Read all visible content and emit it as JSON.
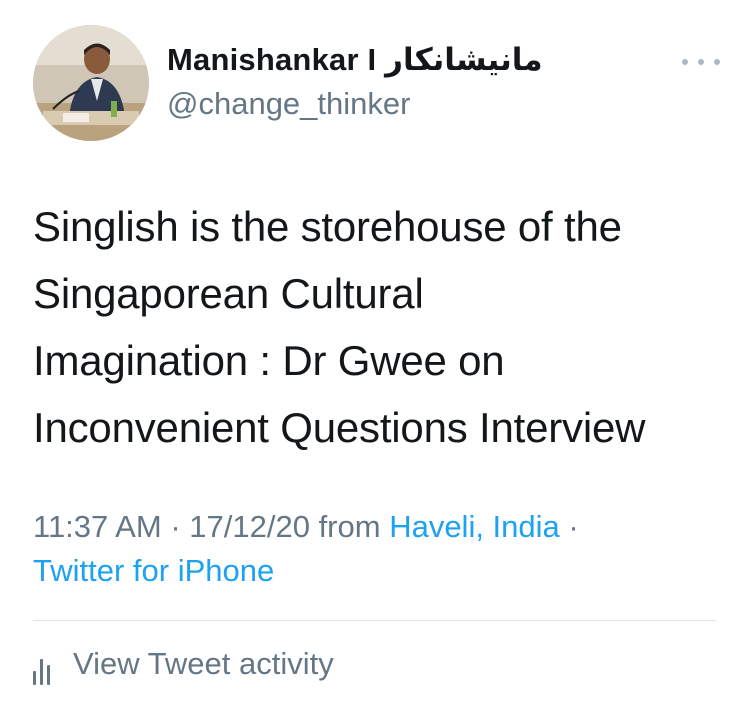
{
  "tweet": {
    "author": {
      "display_name": "Manishankar I مانیشانکار",
      "handle": "@change_thinker",
      "avatar_icon": "user-avatar-photo"
    },
    "more_icon": "more-dots-icon",
    "text_lines": [
      "Singlish is the storehouse of the",
      "Singaporean Cultural",
      "Imagination : Dr Gwee on",
      "Inconvenient Questions Interview"
    ],
    "time": "11:37 AM",
    "separator": "·",
    "date": "17/12/20",
    "from_label": "from",
    "location": "Haveli, India",
    "client": "Twitter for iPhone",
    "activity": {
      "icon": "bar-chart-icon",
      "label": "View Tweet activity"
    }
  },
  "colors": {
    "text": "#14171a",
    "secondary": "#657786",
    "link": "#1da1f2",
    "divider": "#e1e8ed"
  }
}
